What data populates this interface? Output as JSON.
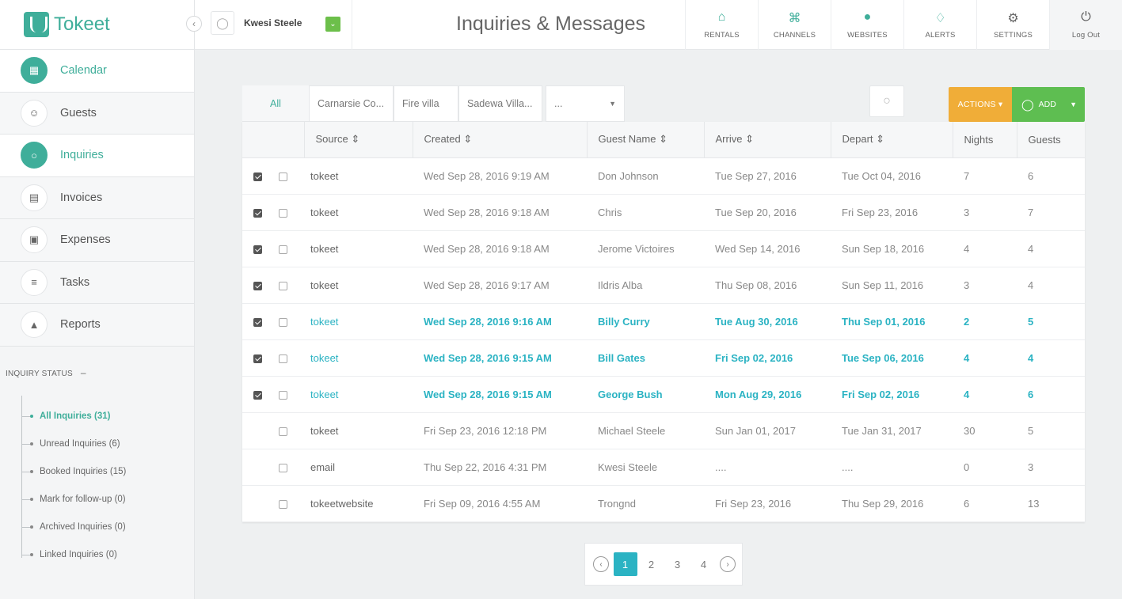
{
  "app": {
    "name": "Tokeet"
  },
  "user": {
    "name": "Kwesi Steele"
  },
  "page": {
    "title": "Inquiries & Messages"
  },
  "topnav": [
    {
      "label": "RENTALS",
      "icon": "home-icon"
    },
    {
      "label": "CHANNELS",
      "icon": "share-icon"
    },
    {
      "label": "WEBSITES",
      "icon": "globe-icon"
    },
    {
      "label": "ALERTS",
      "icon": "bell-icon"
    },
    {
      "label": "SETTINGS",
      "icon": "gear-icon"
    },
    {
      "label": "Log Out",
      "icon": "power-icon"
    }
  ],
  "sidebar": {
    "items": [
      {
        "label": "Calendar",
        "icon": "calendar-icon",
        "active": true
      },
      {
        "label": "Guests",
        "icon": "users-icon",
        "active": false
      },
      {
        "label": "Inquiries",
        "icon": "chat-icon",
        "active": true
      },
      {
        "label": "Invoices",
        "icon": "invoice-icon",
        "active": false
      },
      {
        "label": "Expenses",
        "icon": "money-icon",
        "active": false
      },
      {
        "label": "Tasks",
        "icon": "list-icon",
        "active": false
      },
      {
        "label": "Reports",
        "icon": "chart-icon",
        "active": false
      }
    ],
    "status_heading": "INQUIRY STATUS",
    "status_toggle": "–",
    "statuses": [
      {
        "label": "All Inquiries (31)",
        "active": true
      },
      {
        "label": "Unread Inquiries (6)",
        "active": false
      },
      {
        "label": "Booked Inquiries (15)",
        "active": false
      },
      {
        "label": "Mark for follow-up (0)",
        "active": false
      },
      {
        "label": "Archived Inquiries (0)",
        "active": false
      },
      {
        "label": "Linked Inquiries (0)",
        "active": false
      }
    ]
  },
  "filters": {
    "all": "All",
    "rentals": [
      "Carnarsie Co...",
      "Fire villa",
      "Sadewa Villa..."
    ],
    "more": "...",
    "actions": "ACTIONS",
    "add": "ADD"
  },
  "table": {
    "columns": [
      "Source",
      "Created",
      "Guest Name",
      "Arrive",
      "Depart",
      "Nights",
      "Guests"
    ],
    "rows": [
      {
        "checked": true,
        "highlight": false,
        "source": "tokeet",
        "created": "Wed Sep 28, 2016 9:19 AM",
        "guest": "Don Johnson",
        "arrive": "Tue Sep 27, 2016",
        "depart": "Tue Oct 04, 2016",
        "nights": "7",
        "guests": "6"
      },
      {
        "checked": true,
        "highlight": false,
        "source": "tokeet",
        "created": "Wed Sep 28, 2016 9:18 AM",
        "guest": "Chris",
        "arrive": "Tue Sep 20, 2016",
        "depart": "Fri Sep 23, 2016",
        "nights": "3",
        "guests": "7"
      },
      {
        "checked": true,
        "highlight": false,
        "source": "tokeet",
        "created": "Wed Sep 28, 2016 9:18 AM",
        "guest": "Jerome Victoires",
        "arrive": "Wed Sep 14, 2016",
        "depart": "Sun Sep 18, 2016",
        "nights": "4",
        "guests": "4"
      },
      {
        "checked": true,
        "highlight": false,
        "source": "tokeet",
        "created": "Wed Sep 28, 2016 9:17 AM",
        "guest": "Ildris Alba",
        "arrive": "Thu Sep 08, 2016",
        "depart": "Sun Sep 11, 2016",
        "nights": "3",
        "guests": "4"
      },
      {
        "checked": true,
        "highlight": true,
        "source": "tokeet",
        "created": "Wed Sep 28, 2016 9:16 AM",
        "guest": "Billy Curry",
        "arrive": "Tue Aug 30, 2016",
        "depart": "Thu Sep 01, 2016",
        "nights": "2",
        "guests": "5"
      },
      {
        "checked": true,
        "highlight": true,
        "source": "tokeet",
        "created": "Wed Sep 28, 2016 9:15 AM",
        "guest": "Bill Gates",
        "arrive": "Fri Sep 02, 2016",
        "depart": "Tue Sep 06, 2016",
        "nights": "4",
        "guests": "4"
      },
      {
        "checked": true,
        "highlight": true,
        "source": "tokeet",
        "created": "Wed Sep 28, 2016 9:15 AM",
        "guest": "George Bush",
        "arrive": "Mon Aug 29, 2016",
        "depart": "Fri Sep 02, 2016",
        "nights": "4",
        "guests": "6"
      },
      {
        "checked": false,
        "highlight": false,
        "source": "tokeet",
        "created": "Fri Sep 23, 2016 12:18 PM",
        "guest": "Michael Steele",
        "arrive": "Sun Jan 01, 2017",
        "depart": "Tue Jan 31, 2017",
        "nights": "30",
        "guests": "5"
      },
      {
        "checked": false,
        "highlight": false,
        "source": "email",
        "created": "Thu Sep 22, 2016 4:31 PM",
        "guest": "Kwesi Steele",
        "arrive": "....",
        "depart": "....",
        "nights": "0",
        "guests": "3"
      },
      {
        "checked": false,
        "highlight": false,
        "source": "tokeetwebsite",
        "created": "Fri Sep 09, 2016 4:55 AM",
        "guest": "Trongnd",
        "arrive": "Fri Sep 23, 2016",
        "depart": "Thu Sep 29, 2016",
        "nights": "6",
        "guests": "13"
      }
    ]
  },
  "pagination": {
    "pages": [
      "1",
      "2",
      "3",
      "4"
    ],
    "current": "1"
  },
  "colors": {
    "brand": "#3fae9a",
    "highlight": "#2bb3c3",
    "actions": "#f0ad38",
    "add": "#5ebe51"
  }
}
